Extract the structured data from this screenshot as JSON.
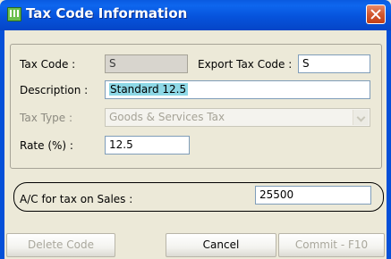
{
  "window": {
    "title": "Tax Code Information"
  },
  "form": {
    "tax_code": {
      "label": "Tax Code :",
      "value": "S"
    },
    "export_tax_code": {
      "label": "Export Tax Code :",
      "value": "S"
    },
    "description": {
      "label": "Description :",
      "value": "Standard 12.5"
    },
    "tax_type": {
      "label": "Tax Type :",
      "value": "Goods & Services Tax"
    },
    "rate": {
      "label": "Rate (%) :",
      "value": "12.5"
    },
    "sales_account": {
      "label": "A/C for tax on Sales :",
      "value": "25500"
    }
  },
  "buttons": {
    "delete": "Delete Code",
    "cancel": "Cancel",
    "commit": "Commit - F10"
  },
  "colors": {
    "titlebar": "#0653dc",
    "dialog_bg": "#ece9d8",
    "selection": "#8ed8e6",
    "close_button": "#d2582f"
  }
}
